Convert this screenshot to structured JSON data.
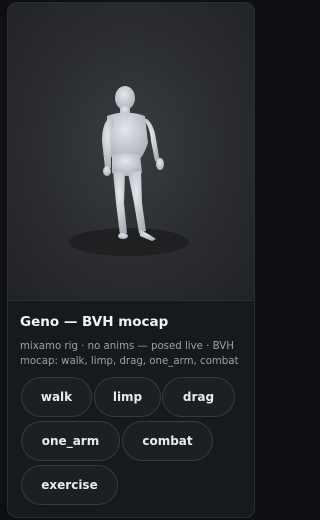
{
  "card": {
    "title": "Geno — BVH mocap",
    "description": "mixamo rig · no anims — posed live · BVH mocap: walk, limp, drag, one_arm, combat"
  },
  "animations": [
    {
      "label": "walk"
    },
    {
      "label": "limp"
    },
    {
      "label": "drag"
    },
    {
      "label": "one_arm"
    },
    {
      "label": "combat"
    },
    {
      "label": "exercise"
    }
  ],
  "colors": {
    "background": "#0d0f12",
    "card": "#16191d",
    "figure": "#c8ccd4",
    "chip_border": "#363b41"
  }
}
